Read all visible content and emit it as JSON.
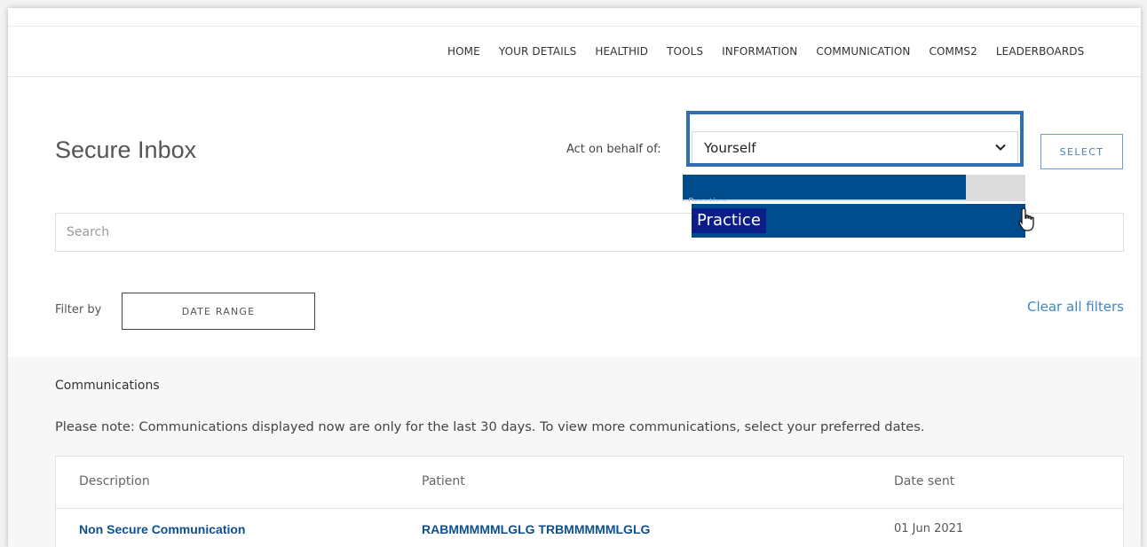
{
  "nav": {
    "items": [
      "HOME",
      "YOUR DETAILS",
      "HEALTHID",
      "TOOLS",
      "INFORMATION",
      "COMMUNICATION",
      "COMMS2",
      "LEADERBOARDS"
    ]
  },
  "page": {
    "title": "Secure Inbox"
  },
  "behalf": {
    "label": "Act on behalf of:",
    "selected": "Yourself",
    "select_button": "SELECT",
    "dropdown_options": [
      "Practice"
    ]
  },
  "search": {
    "placeholder": "Search"
  },
  "filters": {
    "label": "Filter by",
    "date_range_button": "DATE RANGE",
    "clear_link": "Clear all filters"
  },
  "communications": {
    "title": "Communications",
    "note": "Please note: Communications displayed now are only for the last 30 days. To view more communications, select your preferred dates.",
    "columns": [
      "Description",
      "Patient",
      "Date sent"
    ],
    "rows": [
      {
        "description": "Non Secure Communication",
        "patient": "RABMMMMMLGLG TRBMMMMMLGLG",
        "date_sent": "01 Jun 2021"
      }
    ]
  },
  "colors": {
    "accent": "#2f6eb5",
    "link": "#0e4f8d",
    "dropdown_highlight": "#004b8c"
  }
}
